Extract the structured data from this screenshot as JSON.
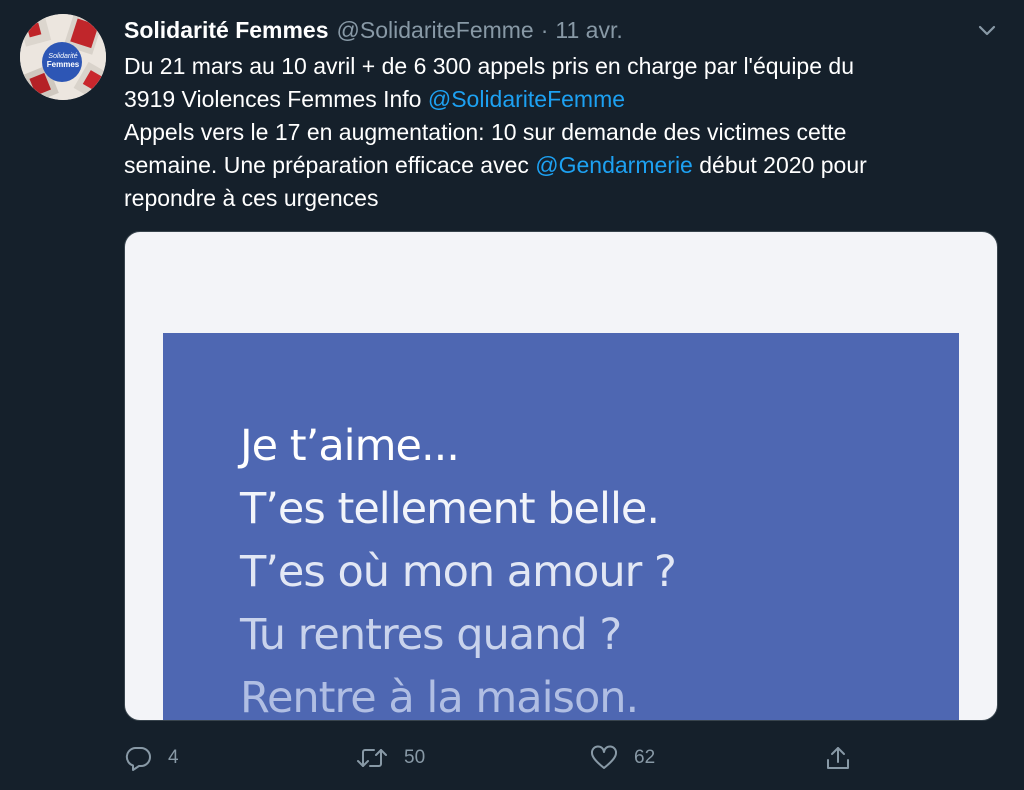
{
  "author": {
    "display_name": "Solidarité Femmes",
    "handle": "@SolidariteFemme",
    "separator": "·",
    "date": "11 avr.",
    "avatar_text_top": "Solidarité",
    "avatar_text_bottom": "Femmes"
  },
  "tweet": {
    "line1": "Du 21 mars au 10 avril + de 6 300 appels pris en charge par l'équipe du",
    "line2_text": "3919 Violences Femmes Info ",
    "line2_mention": "@SolidariteFemme",
    "line3": "Appels vers le 17 en augmentation: 10 sur demande des victimes cette",
    "line4_pre": "semaine. Une préparation efficace avec ",
    "line4_mention": "@Gendarmerie",
    "line4_post": " début 2020 pour",
    "line5": "repondre à ces urgences"
  },
  "media": {
    "poster_lines": [
      "Je t’aime...",
      "T’es tellement belle.",
      "T’es où mon amour ?",
      "Tu rentres quand ?",
      "Rentre à la maison."
    ]
  },
  "actions": {
    "reply_count": "4",
    "retweet_count": "50",
    "like_count": "62"
  },
  "colors": {
    "background": "#15202b",
    "link": "#1da1f2",
    "muted": "#8899a6",
    "poster_blue": "#4e67b2"
  },
  "icons": {
    "caret": "chevron-down-icon",
    "reply": "reply-icon",
    "retweet": "retweet-icon",
    "like": "heart-icon",
    "share": "share-icon"
  }
}
